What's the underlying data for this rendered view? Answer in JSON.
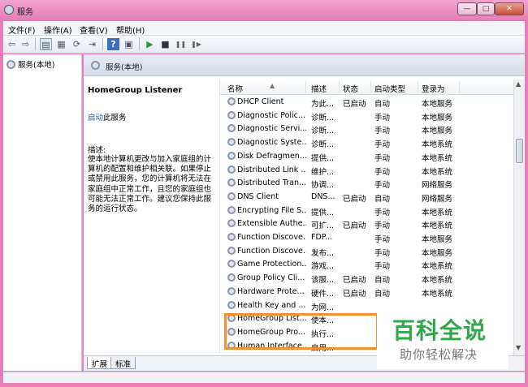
{
  "window": {
    "title": "服务"
  },
  "menu": [
    "文件(F)",
    "操作(A)",
    "查看(V)",
    "帮助(H)"
  ],
  "toolbar": {
    "back_icon": "back-arrow-icon",
    "forward_icon": "forward-arrow-icon",
    "play_symbol": "▶",
    "stop_symbol": "■",
    "pause_symbol": "❚❚",
    "restart_symbol": "❚▶"
  },
  "tree": {
    "root_label": "服务(本地)"
  },
  "pane": {
    "header": "服务(本地)",
    "selected_service": "HomeGroup Listener",
    "start_link": "启动",
    "start_suffix": "此服务",
    "desc_label": "描述:",
    "description": "使本地计算机更改与加入家庭组的计算机的配置和维护相关联。如果停止或禁用此服务，您的计算机将无法在家庭组中正常工作，且您的家庭组也可能无法正常工作。建议您保持此服务的运行状态。"
  },
  "columns": {
    "name": "名称",
    "desc": "描述",
    "status": "状态",
    "startup": "启动类型",
    "logon": "登录为"
  },
  "services": [
    {
      "name": "DHCP Client",
      "desc": "为此...",
      "status": "已启动",
      "startup": "自动",
      "logon": "本地服务"
    },
    {
      "name": "Diagnostic Polic...",
      "desc": "诊断...",
      "status": "",
      "startup": "手动",
      "logon": "本地服务"
    },
    {
      "name": "Diagnostic Servi...",
      "desc": "诊断...",
      "status": "",
      "startup": "手动",
      "logon": "本地服务"
    },
    {
      "name": "Diagnostic Syste...",
      "desc": "诊断...",
      "status": "",
      "startup": "手动",
      "logon": "本地系统"
    },
    {
      "name": "Disk Defragmen...",
      "desc": "提供...",
      "status": "",
      "startup": "手动",
      "logon": "本地系统"
    },
    {
      "name": "Distributed Link ...",
      "desc": "维护...",
      "status": "",
      "startup": "手动",
      "logon": "本地系统"
    },
    {
      "name": "Distributed Tran...",
      "desc": "协调...",
      "status": "",
      "startup": "手动",
      "logon": "网络服务"
    },
    {
      "name": "DNS Client",
      "desc": "DNS...",
      "status": "已启动",
      "startup": "自动",
      "logon": "网络服务"
    },
    {
      "name": "Encrypting File S...",
      "desc": "提供...",
      "status": "",
      "startup": "手动",
      "logon": "本地系统"
    },
    {
      "name": "Extensible Authe...",
      "desc": "可扩...",
      "status": "已启动",
      "startup": "手动",
      "logon": "本地系统"
    },
    {
      "name": "Function Discove...",
      "desc": "FDP...",
      "status": "",
      "startup": "手动",
      "logon": "本地服务"
    },
    {
      "name": "Function Discove...",
      "desc": "发布...",
      "status": "",
      "startup": "手动",
      "logon": "本地服务"
    },
    {
      "name": "Game Protection...",
      "desc": "游戏...",
      "status": "",
      "startup": "手动",
      "logon": "本地系统"
    },
    {
      "name": "Group Policy Cli...",
      "desc": "该服...",
      "status": "已启动",
      "startup": "自动",
      "logon": "本地系统"
    },
    {
      "name": "Hardware Prote...",
      "desc": "硬件...",
      "status": "已启动",
      "startup": "自动",
      "logon": "本地系统"
    },
    {
      "name": "Health Key and ...",
      "desc": "为网...",
      "status": "",
      "startup": "",
      "logon": ""
    },
    {
      "name": "HomeGroup List...",
      "desc": "使本...",
      "status": "",
      "startup": "",
      "logon": ""
    },
    {
      "name": "HomeGroup Pro...",
      "desc": "执行...",
      "status": "",
      "startup": "",
      "logon": ""
    },
    {
      "name": "Human Interface...",
      "desc": "启用...",
      "status": "",
      "startup": "",
      "logon": ""
    }
  ],
  "tabs": [
    "扩展",
    "标准"
  ],
  "watermark": {
    "main": "百科全说",
    "sub": "助你轻松解决"
  },
  "colors": {
    "highlight": "#f0902f",
    "watermark_green": "#2fa84a",
    "link": "#1560bd"
  }
}
